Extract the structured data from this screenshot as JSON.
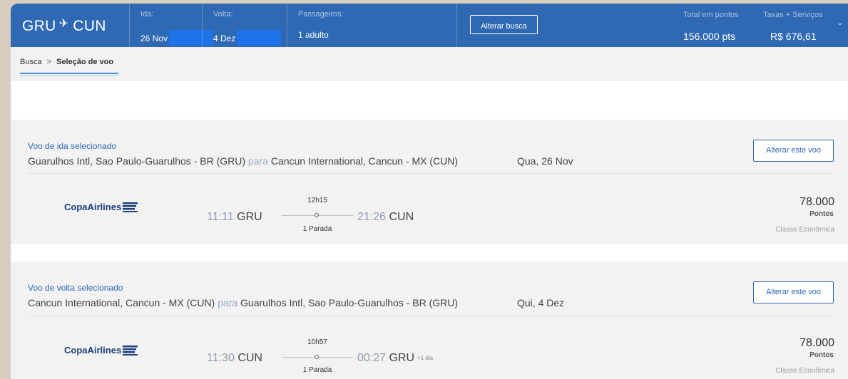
{
  "header": {
    "origin": "GRU",
    "destination": "CUN",
    "ida_label": "Ida:",
    "ida_value": "26 Nov",
    "volta_label": "Volta:",
    "volta_value": "4 Dez",
    "passageiros_label": "Passageiros:",
    "passageiros_value": "1 adulto",
    "alter_search": "Alterar busca",
    "total_pontos_label": "Total em pontos",
    "total_pontos_value": "156.000 pts",
    "taxas_label": "Taxas + Serviços",
    "taxas_value": "R$ 676,61",
    "expand_icon": "chevron-down-icon"
  },
  "breadcrumb": {
    "item1": "Busca",
    "separator": ">",
    "current": "Seleção de voo"
  },
  "outbound": {
    "title": "Voo de ida selecionado",
    "from": "Guarulhos Intl, Sao Paulo-Guarulhos - BR (GRU)",
    "connector": "para",
    "to": "Cancun International, Cancun - MX (CUN)",
    "date": "Qua, 26 Nov",
    "alter_label": "Alterar este voo",
    "airline": "CopaAirlines",
    "dep_time": "11:11",
    "dep_code": "GRU",
    "duration": "12h15",
    "stops": "1 Parada",
    "arr_time": "21:26",
    "arr_code": "CUN",
    "price": "78.000",
    "price_unit": "Pontos",
    "fare_class": "Classe Econômica"
  },
  "inbound": {
    "title": "Voo de volta selecionado",
    "from": "Cancun International, Cancun - MX (CUN)",
    "connector": "para",
    "to": "Guarulhos Intl, Sao Paulo-Guarulhos - BR (GRU)",
    "date": "Qui, 4 Dez",
    "alter_label": "Alterar este voo",
    "airline": "CopaAirlines",
    "dep_time": "11:30",
    "dep_code": "CUN",
    "duration": "10h57",
    "stops": "1 Parada",
    "arr_time": "00:27",
    "arr_code": "GRU",
    "plus_day": "+1 dia",
    "price": "78.000",
    "price_unit": "Pontos",
    "fare_class": "Classe Econômica"
  },
  "colors": {
    "header_bg": "#2f69b3",
    "accent": "#2f69b3",
    "section_bg": "#f2f2f2",
    "redaction": "#1e73e8"
  }
}
